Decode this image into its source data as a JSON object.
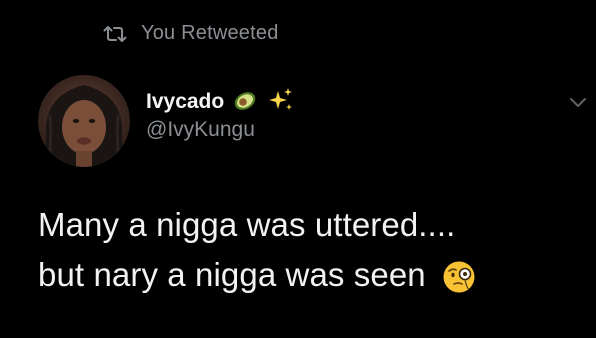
{
  "retweet": {
    "label": "You Retweeted",
    "icon": "retweet-icon"
  },
  "author": {
    "display_name": "Ivycado",
    "handle": "@IvyKungu",
    "avatar": "avatar-photo",
    "name_emojis": [
      "avocado-icon",
      "sparkles-icon"
    ]
  },
  "menu": {
    "icon": "chevron-down-icon"
  },
  "tweet": {
    "line1": "Many a nigga was uttered....",
    "line2": "but nary a nigga was seen",
    "emoji": "face-with-monocle-icon"
  },
  "colors": {
    "background": "#000000",
    "text": "#f2f2f2",
    "secondary": "#8b8f94"
  }
}
